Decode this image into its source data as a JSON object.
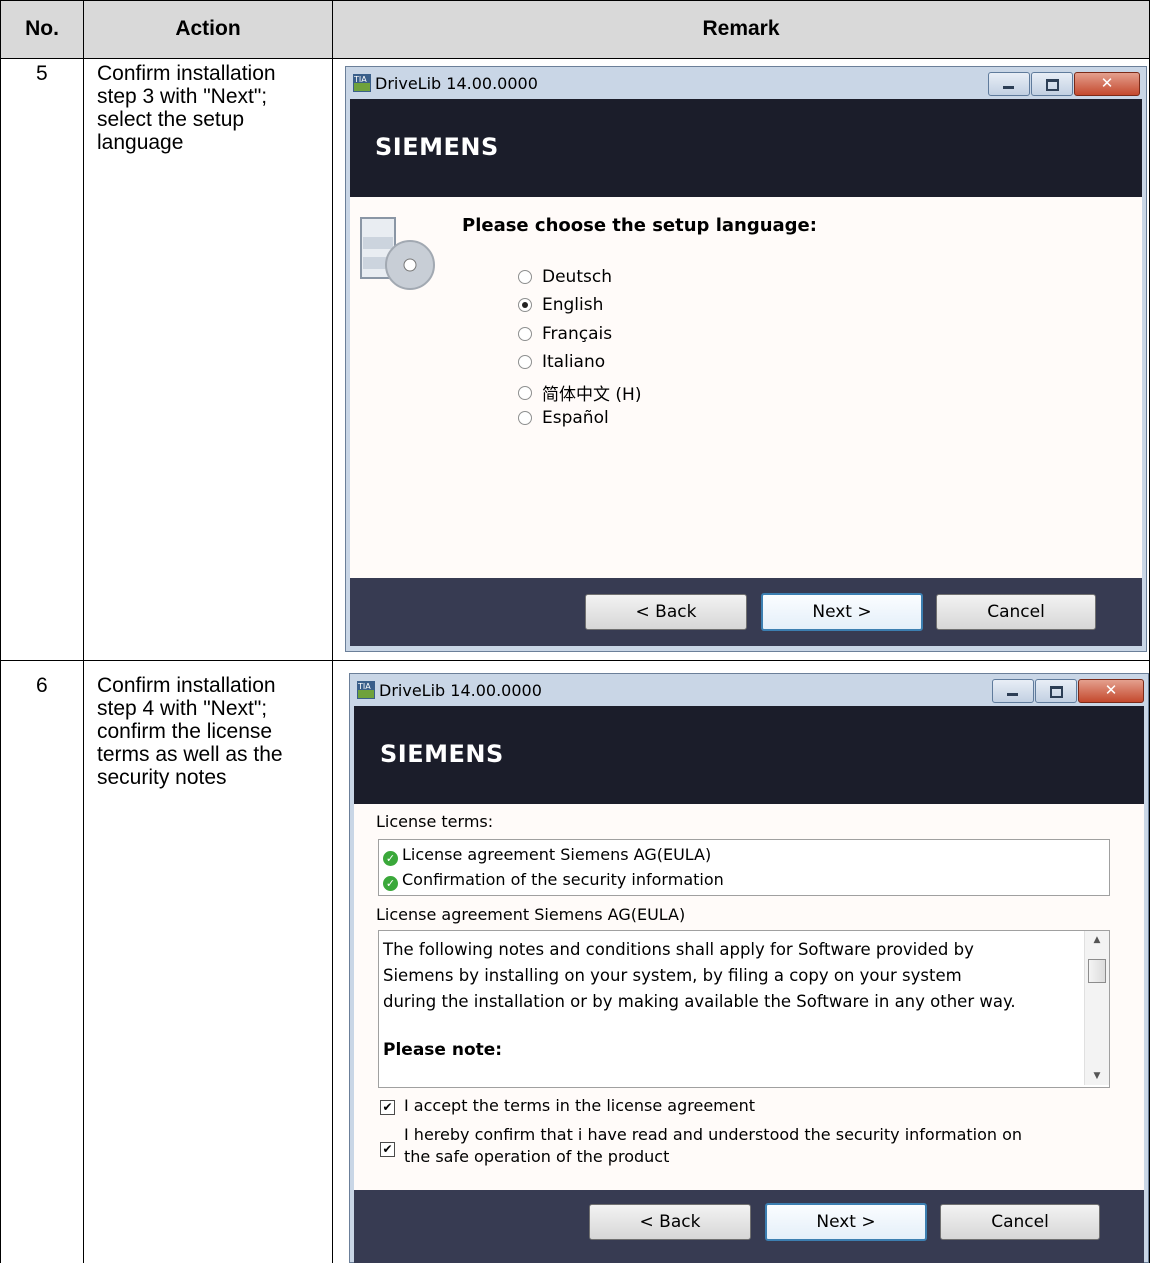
{
  "table": {
    "headers": [
      "No.",
      "Action",
      "Remark"
    ],
    "rows": [
      {
        "no": "5",
        "action_lines": [
          "Confirm installation",
          "step 3 with \"Next\";",
          "select the setup",
          "language"
        ]
      },
      {
        "no": "6",
        "action_lines": [
          "Confirm installation",
          "step 4 with \"Next\";",
          "confirm the license",
          "terms as well as the",
          "security notes"
        ]
      }
    ]
  },
  "dialog1": {
    "title": "DriveLib 14.00.0000",
    "brand": "SIEMENS",
    "heading": "Please choose the setup language:",
    "languages": [
      {
        "label": "Deutsch",
        "selected": false
      },
      {
        "label": "English",
        "selected": true
      },
      {
        "label": "Français",
        "selected": false
      },
      {
        "label": "Italiano",
        "selected": false
      },
      {
        "label": "简体中文 (H)",
        "selected": false
      },
      {
        "label": "Español",
        "selected": false
      }
    ],
    "buttons": {
      "back": "< Back",
      "next": "Next >",
      "cancel": "Cancel"
    }
  },
  "dialog2": {
    "title": "DriveLib 14.00.0000",
    "brand": "SIEMENS",
    "license_terms_label": "License terms:",
    "license_items": [
      "License agreement Siemens AG(EULA)",
      "Confirmation of the security information"
    ],
    "eula_label": "License agreement Siemens AG(EULA)",
    "eula_lines": [
      "The following notes and conditions shall apply for Software provided by",
      "Siemens by installing on your system, by filing a copy on your system",
      "during the installation or by making available the Software in any other way."
    ],
    "eula_note": "Please note:",
    "accept_terms": {
      "label": "I accept the terms in the license agreement",
      "checked": true
    },
    "confirm_security": {
      "line1": "I hereby confirm that i have read and understood the security information on",
      "line2": "the safe operation of the product",
      "checked": true
    },
    "buttons": {
      "back": "< Back",
      "next": "Next >",
      "cancel": "Cancel"
    }
  },
  "colors": {
    "banner": "#1b1d2a",
    "footer": "#373b52",
    "header_fill": "#d9d9d9"
  }
}
